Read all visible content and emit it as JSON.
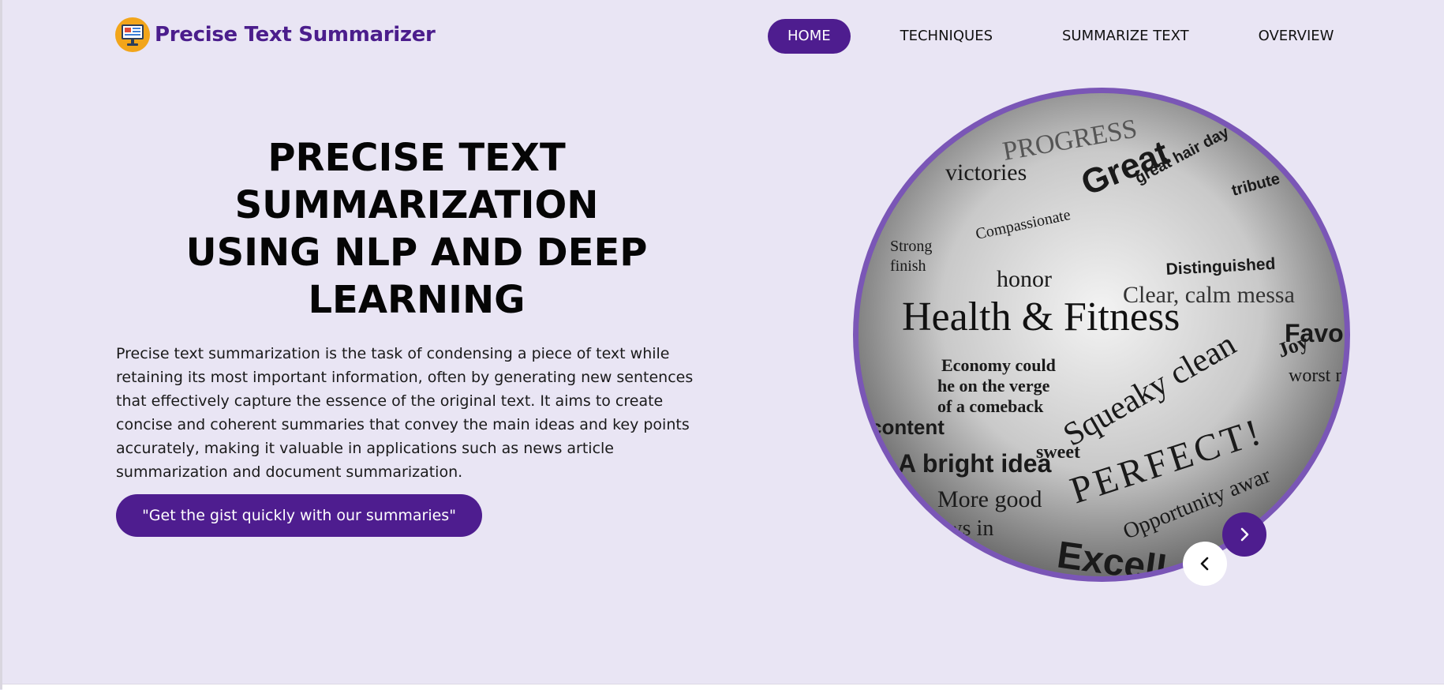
{
  "brand": {
    "name": "Precise Text Summarizer",
    "icon": "monitor-document-icon",
    "icon_bg": "#f2a51a"
  },
  "nav": {
    "items": [
      {
        "label": "HOME",
        "active": true
      },
      {
        "label": "TECHNIQUES",
        "active": false
      },
      {
        "label": "SUMMARIZE TEXT",
        "active": false
      },
      {
        "label": "OVERVIEW",
        "active": false
      }
    ]
  },
  "hero": {
    "title_lines": [
      "PRECISE TEXT",
      "SUMMARIZATION",
      "USING NLP AND DEEP",
      "LEARNING"
    ],
    "description": "Precise text summarization is the task of condensing a piece of text while retaining its most important information, often by generating new sentences that effectively capture the essence of the original text. It aims to create concise and coherent summaries that convey the main ideas and key points accurately, making it valuable in applications such as news article summarization and document summarization.",
    "cta_label": "\"Get the gist quickly with our summaries\""
  },
  "carousel": {
    "image_words": [
      "PROGRESS",
      "victories",
      "Great",
      "great hair day",
      "tribute",
      "honor",
      "Distinguished",
      "Health & Fitness",
      "Clear, calm messa",
      "Favo",
      "Economy could",
      "he on the verge",
      "of a comeback",
      "content",
      "Squeaky clean",
      "A bright idea",
      "sweet",
      "PERFECT!",
      "More good",
      "Opportunity awar",
      "news in",
      "Excell",
      "Compassionate",
      "Strong",
      "finish",
      "Joy",
      "worst m"
    ],
    "next_icon": "chevron-right-icon",
    "prev_icon": "chevron-left-icon"
  },
  "colors": {
    "background": "#e9e5f4",
    "accent": "#4e1d8f",
    "ring": "#7a56b6",
    "brand_text": "#4b1d8c"
  }
}
